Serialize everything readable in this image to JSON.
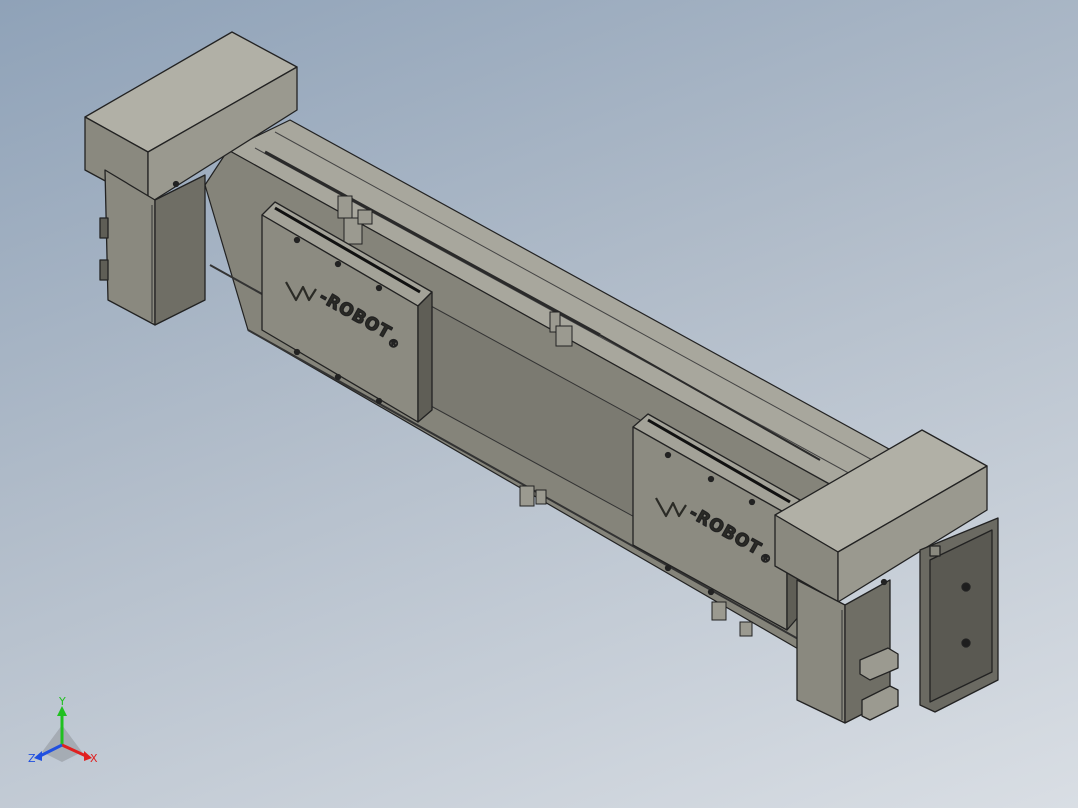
{
  "model": {
    "brand_text_1": "-ROBOT",
    "brand_text_2": "-ROBOT",
    "registered_mark": "®"
  },
  "triad": {
    "x_label": "X",
    "y_label": "Y",
    "z_label": "Z",
    "x_color": "#e02020",
    "y_color": "#20c020",
    "z_color": "#2050e0"
  },
  "colors": {
    "body_front": "#86857c",
    "body_top": "#a6a59b",
    "body_dark": "#5c5b53",
    "edge": "#222222",
    "background_top": "#8fa2b8",
    "background_bottom": "#d9dee4"
  }
}
